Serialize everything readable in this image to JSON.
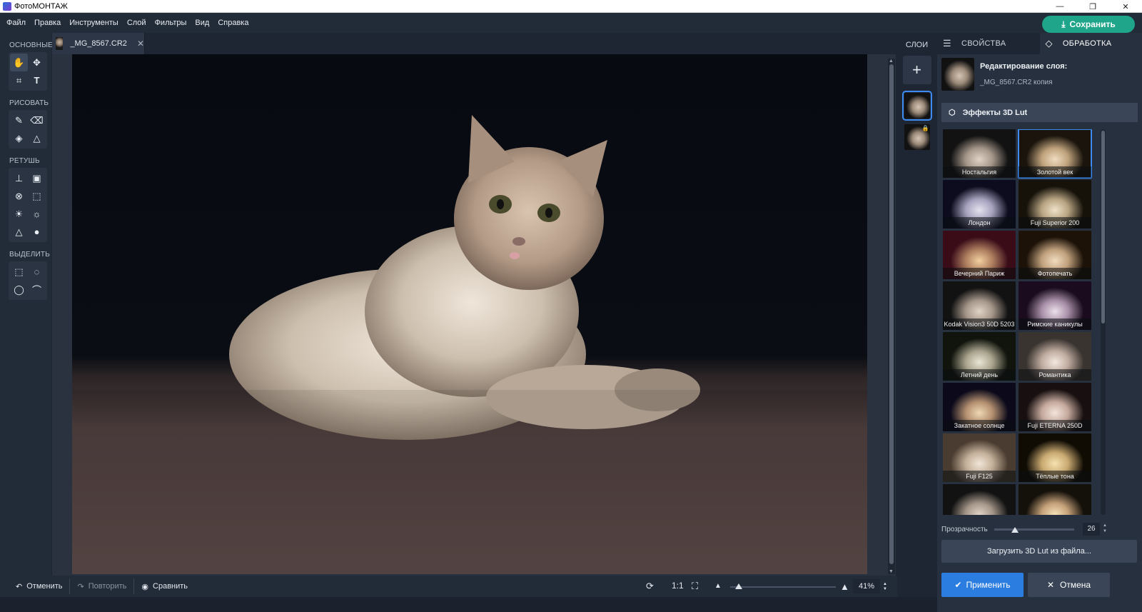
{
  "window": {
    "title": "ФотоМОНТАЖ",
    "controls": [
      "—",
      "❐",
      "✕"
    ]
  },
  "menu": [
    "Файл",
    "Правка",
    "Инструменты",
    "Слой",
    "Фильтры",
    "Вид",
    "Справка"
  ],
  "save_button": "Сохранить",
  "tools": {
    "groups": [
      {
        "label": "ОСНОВНЫЕ",
        "items": [
          "hand-icon",
          "move-icon",
          "crop-icon",
          "text-icon"
        ]
      },
      {
        "label": "РИСОВАТЬ",
        "items": [
          "brush-icon",
          "eraser-icon",
          "fill-icon",
          "shapes-icon"
        ]
      },
      {
        "label": "РЕТУШЬ",
        "items": [
          "stamp-icon",
          "patch-icon",
          "heal-icon",
          "frame-icon",
          "dodge-icon",
          "burn-icon",
          "sharpen-icon",
          "blur-icon"
        ]
      },
      {
        "label": "ВЫДЕЛИТЬ",
        "items": [
          "rect-select-icon",
          "ellipse-select-icon",
          "lasso-icon",
          "poly-lasso-icon"
        ]
      }
    ]
  },
  "document_tab": {
    "name": "_MG_8567.CR2"
  },
  "layers": {
    "label": "СЛОИ",
    "add": "+"
  },
  "right_panel": {
    "tabs": [
      "СВОЙСТВА",
      "ОБРАБОТКА"
    ],
    "layer_edit_title": "Редактирование слоя:",
    "layer_name": "_MG_8567.CR2 копия",
    "effects_title": "Эффекты 3D Lut",
    "effects": [
      "Ностальгия",
      "Золотой век",
      "Лондон",
      "Fuji Superior 200",
      "Вечерний Париж",
      "Фотопечать",
      "Kodak Vision3 50D 5203",
      "Римские каникулы",
      "Летний день",
      "Романтика",
      "Закатное солнце",
      "Fuji ETERNA 250D",
      "Fuji F125",
      "Тёплые тона",
      "",
      ""
    ],
    "selected_effect": "Золотой век",
    "opacity_label": "Прозрачность",
    "opacity_value": "26",
    "load_button": "Загрузить 3D Lut из файла...",
    "apply_button": "Применить",
    "cancel_button": "Отмена"
  },
  "bottom": {
    "undo": "Отменить",
    "redo": "Повторить",
    "compare": "Сравнить",
    "one_to_one": "1:1",
    "zoom": "41%"
  },
  "colors": {
    "accent_green": "#1ea58a",
    "accent_blue": "#2c7de0",
    "selection": "#3d8bf0"
  }
}
